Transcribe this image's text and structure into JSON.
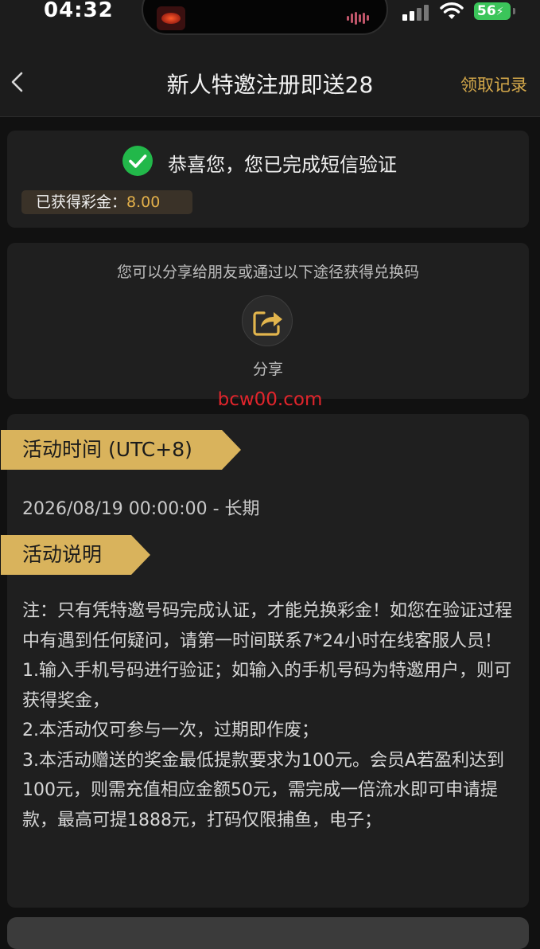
{
  "status_bar": {
    "time": "04:32",
    "battery": "56"
  },
  "header": {
    "title": "新人特邀注册即送28",
    "records_link": "领取记录"
  },
  "verification": {
    "message": "恭喜您，您已完成短信验证",
    "bonus_label": "已获得彩金：",
    "bonus_value": "8.00"
  },
  "share": {
    "hint": "您可以分享给朋友或通过以下途径获得兑换码",
    "button_label": "分享"
  },
  "watermark": "bcw00.com",
  "activity": {
    "time_heading": "活动时间 (UTC+8)",
    "period": "2026/08/19 00:00:00 - 长期",
    "desc_heading": "活动说明",
    "rules": [
      "注：只有凭特邀号码完成认证，才能兑换彩金！如您在验证过程中有遇到任何疑问，请第一时间联系7*24小时在线客服人员！",
      "1.输入手机号码进行验证；如输入的手机号码为特邀用户，则可获得奖金，",
      "2.本活动仅可参与一次，过期即作废；",
      "3.本活动赠送的奖金最低提款要求为100元。会员A若盈利达到100元，则需充值相应金额50元，需完成一倍流水即可申请提款，最高可提1888元，打码仅限捕鱼，电子；"
    ]
  },
  "colors": {
    "accent": "#d4a84a",
    "ribbon": "#d9b35c",
    "success": "#22b84a",
    "watermark": "#e0252c",
    "background": "#111111",
    "card": "#1f1f1f"
  },
  "icons": {
    "back": "chevron-left-icon",
    "check": "check-circle-icon",
    "share": "share-icon"
  }
}
